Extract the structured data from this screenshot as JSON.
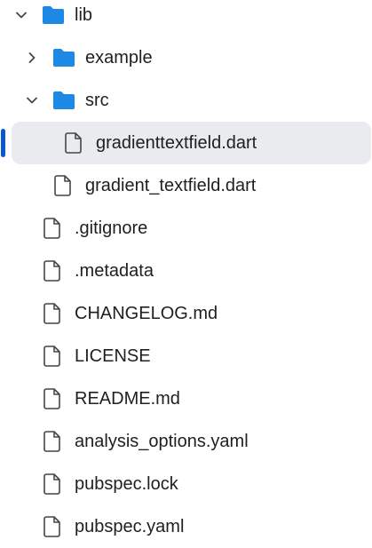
{
  "tree": {
    "items": [
      {
        "label": "lib",
        "type": "folder",
        "expanded": true,
        "icon": "folder-icon",
        "chevron": "chevron-down-icon"
      },
      {
        "label": "example",
        "type": "folder",
        "expanded": false,
        "icon": "folder-icon",
        "chevron": "chevron-right-icon"
      },
      {
        "label": "src",
        "type": "folder",
        "expanded": true,
        "icon": "folder-icon",
        "chevron": "chevron-down-icon"
      },
      {
        "label": "gradienttextfield.dart",
        "type": "file",
        "selected": true,
        "icon": "file-icon"
      },
      {
        "label": "gradient_textfield.dart",
        "type": "file",
        "icon": "file-icon"
      },
      {
        "label": ".gitignore",
        "type": "file",
        "icon": "file-icon"
      },
      {
        "label": ".metadata",
        "type": "file",
        "icon": "file-icon"
      },
      {
        "label": "CHANGELOG.md",
        "type": "file",
        "icon": "file-icon"
      },
      {
        "label": "LICENSE",
        "type": "file",
        "icon": "file-icon"
      },
      {
        "label": "README.md",
        "type": "file",
        "icon": "file-icon"
      },
      {
        "label": "analysis_options.yaml",
        "type": "file",
        "icon": "file-icon"
      },
      {
        "label": "pubspec.lock",
        "type": "file",
        "icon": "file-icon"
      },
      {
        "label": "pubspec.yaml",
        "type": "file",
        "icon": "file-icon"
      }
    ]
  },
  "colors": {
    "folder": "#1e88e5",
    "selection_bg": "#e9ebee",
    "selection_accent": "#0b57d0",
    "text": "#1f1f1f",
    "icon_stroke": "#444746"
  }
}
